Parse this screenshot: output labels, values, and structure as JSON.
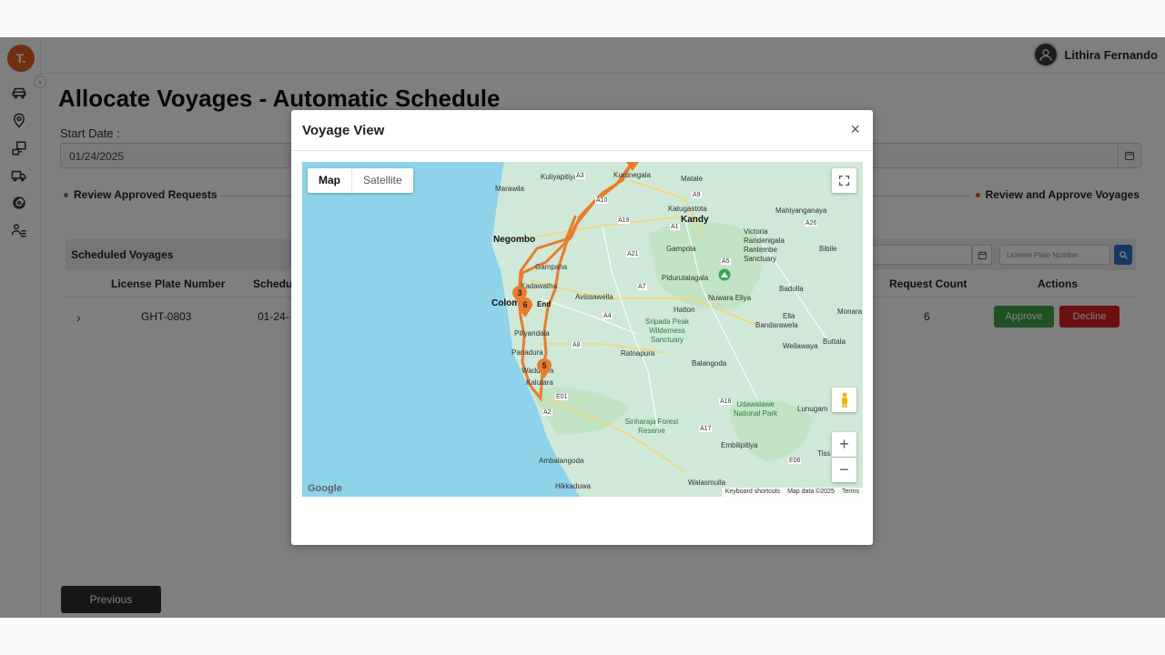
{
  "app": {
    "logo_text": "T.",
    "user_name": "Lithira Fernando"
  },
  "sidebar": {
    "icons": [
      "car-icon",
      "location-pin-icon",
      "requests-icon",
      "truck-icon",
      "route-icon",
      "users-icon"
    ]
  },
  "page": {
    "title": "Allocate Voyages - Automatic Schedule",
    "start_date_label": "Start Date :",
    "start_date_value": "01/24/2025"
  },
  "steps": {
    "first": "Review Approved Requests",
    "last": "Review and Approve Voyages"
  },
  "scheduled": {
    "title": "Scheduled Voyages",
    "license_placeholder": "License Plate Number",
    "columns": [
      "License Plate Number",
      "Schedu",
      "Request Count",
      "Actions"
    ],
    "rows": [
      {
        "license_plate": "GHT-0803",
        "date": "01-24-",
        "request_count": "6",
        "approve_label": "Approve",
        "decline_label": "Decline"
      }
    ]
  },
  "footer": {
    "previous_label": "Previous"
  },
  "modal": {
    "title": "Voyage View",
    "close_symbol": "×",
    "map": {
      "type_map": "Map",
      "type_satellite": "Satellite",
      "zoom_in": "+",
      "zoom_out": "−",
      "google_label": "Google",
      "attribution": [
        "Keyboard shortcuts",
        "Map data ©2025",
        "Terms"
      ],
      "places": [
        "Kuliyapitiya",
        "Kurunegala",
        "Matale",
        "Marawila",
        "Katugastota",
        "Kandy",
        "Victoria Randenigala Rantembe Sanctuary",
        "Mahiyanganaya",
        "Negombo",
        "Gampola",
        "Bibile",
        "Gampaha",
        "Pidurutalagala",
        "Nuwara Eliya",
        "Badulla",
        "Kadawatha",
        "Colombo",
        "End",
        "Avissawella",
        "Hatton",
        "Bandarawela",
        "Monara",
        "Sripada Peak Wilderness Sanctuary",
        "Ella",
        "Piliyandala",
        "Wellawaya",
        "Buttala",
        "Panadura",
        "Ratnapura",
        "Balangoda",
        "Wadduwa",
        "Kalutara",
        "Udawalawe National Park",
        "Lunugam",
        "Sinharaja Forest Reserve",
        "Tiss",
        "Embilipitiya",
        "Ambalangoda",
        "Walasmulla",
        "Hikkaduwa"
      ],
      "road_shields": [
        "A9",
        "A10",
        "A19",
        "A1",
        "A21",
        "A26",
        "A5",
        "A7",
        "A4",
        "A8",
        "E01",
        "A2",
        "A17",
        "A18",
        "E06",
        "A3"
      ],
      "markers": [
        "3",
        "6",
        "5"
      ]
    }
  }
}
